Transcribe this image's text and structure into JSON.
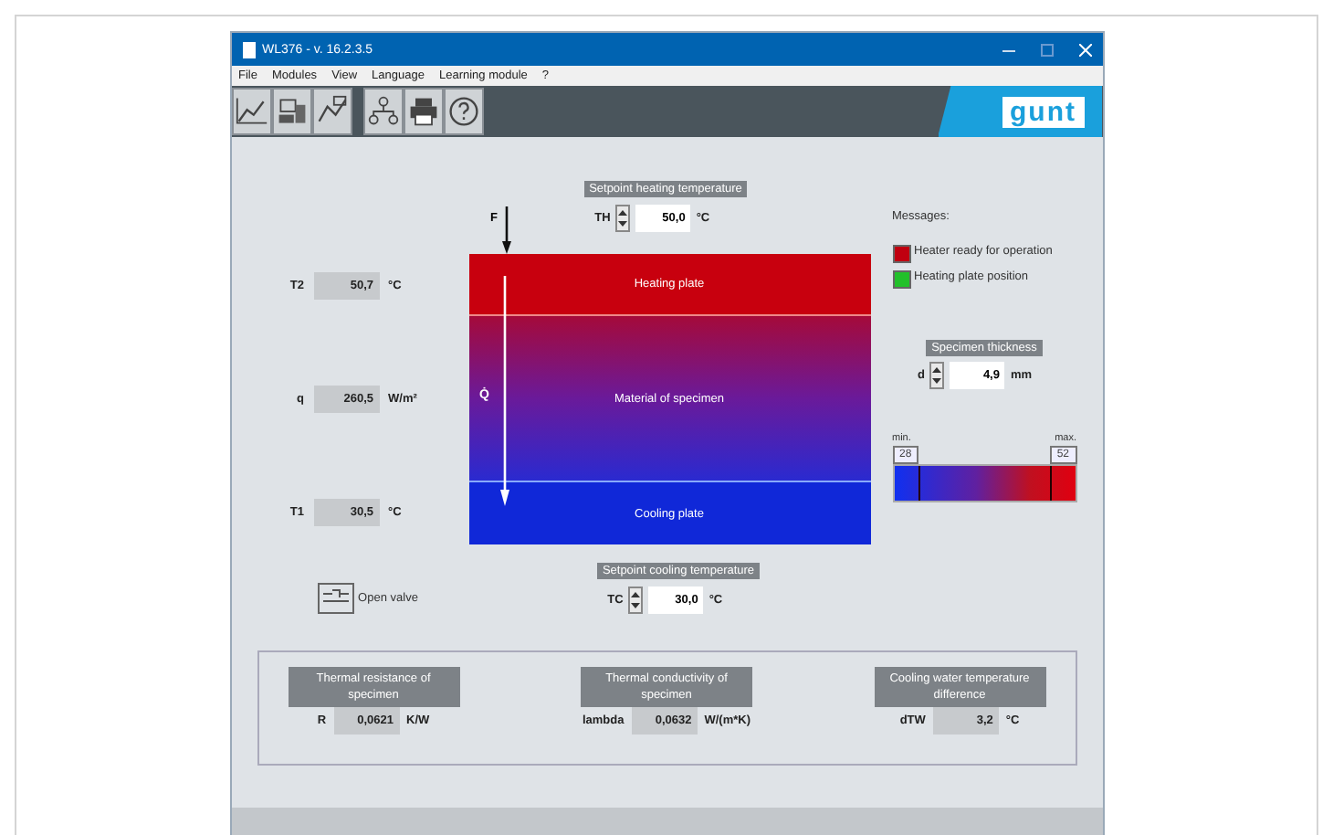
{
  "window": {
    "title": "WL376 - v. 16.2.3.5"
  },
  "menu": [
    "File",
    "Modules",
    "View",
    "Language",
    "Learning module",
    "?"
  ],
  "toolbar": {
    "logo": "gunt"
  },
  "setpoint_heating": {
    "header": "Setpoint heating temperature",
    "label": "TH",
    "value": "50,0",
    "unit": "°C"
  },
  "setpoint_cooling": {
    "header": "Setpoint cooling temperature",
    "label": "TC",
    "value": "30,0",
    "unit": "°C"
  },
  "force_label": "F",
  "heat_flow_label": "Q̇",
  "plates": {
    "heating": "Heating plate",
    "specimen": "Material of specimen",
    "cooling": "Cooling plate"
  },
  "readings": [
    {
      "label": "T2",
      "value": "50,7",
      "unit": "°C"
    },
    {
      "label": "q",
      "value": "260,5",
      "unit": "W/m²"
    },
    {
      "label": "T1",
      "value": "30,5",
      "unit": "°C"
    }
  ],
  "valve_button": "Open valve",
  "messages": {
    "title": "Messages:",
    "items": [
      {
        "text": "Heater ready for operation",
        "color": "#c00010"
      },
      {
        "text": "Heating plate position",
        "color": "#22c02a"
      }
    ]
  },
  "thickness": {
    "header": "Specimen thickness",
    "label": "d",
    "value": "4,9",
    "unit": "mm"
  },
  "scale": {
    "min_label": "min.",
    "min": "28",
    "max_label": "max.",
    "max": "52"
  },
  "results": [
    {
      "header": "Thermal resistance of specimen",
      "label": "R",
      "value": "0,0621",
      "unit": "K/W"
    },
    {
      "header": "Thermal conductivity of specimen",
      "label": "lambda",
      "value": "0,0632",
      "unit": "W/(m*K)"
    },
    {
      "header": "Cooling water temperature difference",
      "label": "dTW",
      "value": "3,2",
      "unit": "°C"
    }
  ]
}
